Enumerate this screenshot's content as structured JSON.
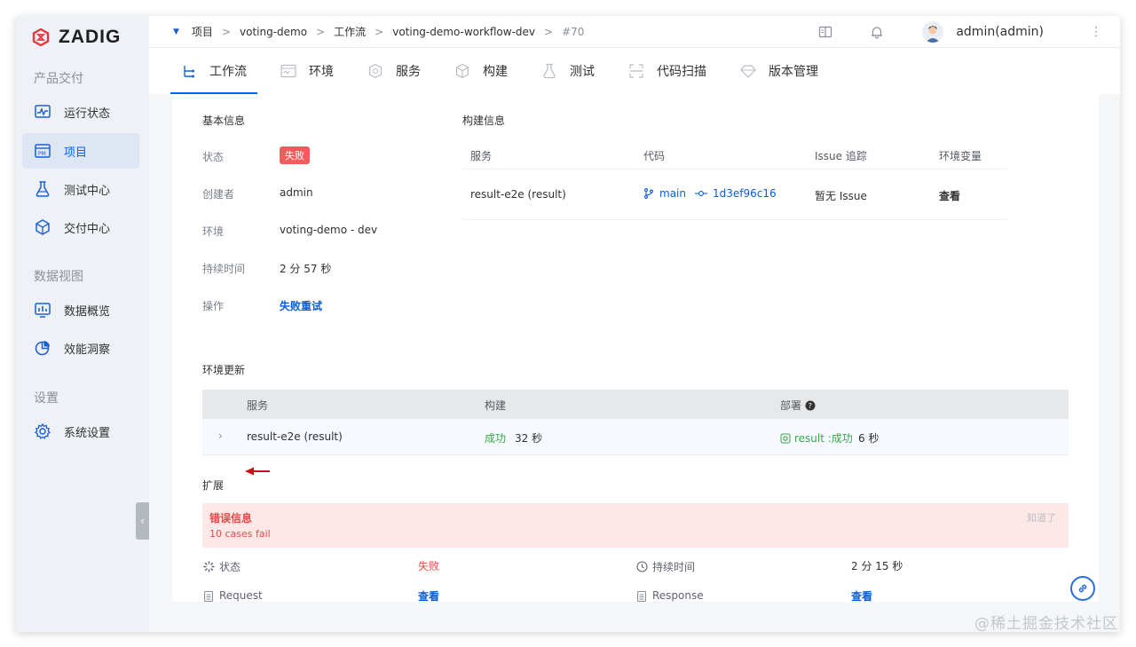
{
  "app": {
    "logo_text": "ZADIG"
  },
  "sidebar": {
    "sections": [
      {
        "title": "产品交付",
        "items": [
          {
            "label": "运行状态",
            "icon": "monitor-pulse-icon"
          },
          {
            "label": "项目",
            "icon": "project-pm-icon",
            "active": true
          },
          {
            "label": "测试中心",
            "icon": "flask-icon"
          },
          {
            "label": "交付中心",
            "icon": "package-icon"
          }
        ]
      },
      {
        "title": "数据视图",
        "items": [
          {
            "label": "数据概览",
            "icon": "dashboard-icon"
          },
          {
            "label": "效能洞察",
            "icon": "pie-chart-icon"
          }
        ]
      },
      {
        "title": "设置",
        "items": [
          {
            "label": "系统设置",
            "icon": "gear-icon"
          }
        ]
      }
    ]
  },
  "breadcrumb": {
    "items": [
      "项目",
      "voting-demo",
      "工作流",
      "voting-demo-workflow-dev",
      "#70"
    ],
    "sep": ">"
  },
  "user": {
    "name": "admin(admin)"
  },
  "tabs": [
    {
      "label": "工作流",
      "active": true
    },
    {
      "label": "环境"
    },
    {
      "label": "服务"
    },
    {
      "label": "构建"
    },
    {
      "label": "测试"
    },
    {
      "label": "代码扫描"
    },
    {
      "label": "版本管理"
    }
  ],
  "basic_info": {
    "title": "基本信息",
    "status_label": "状态",
    "status_value": "失败",
    "creator_label": "创建者",
    "creator_value": "admin",
    "env_label": "环境",
    "env_value": "voting-demo - dev",
    "duration_label": "持续时间",
    "duration_value": "2 分 57 秒",
    "action_label": "操作",
    "action_value": "失败重试"
  },
  "build_info": {
    "title": "构建信息",
    "headers": [
      "服务",
      "代码",
      "Issue 追踪",
      "环境变量"
    ],
    "row": {
      "service": "result-e2e (result)",
      "branch": "main",
      "commit": "1d3ef96c16",
      "issue": "暂无 Issue",
      "env_vars": "查看"
    }
  },
  "env_update": {
    "title": "环境更新",
    "headers": [
      "服务",
      "构建",
      "部署"
    ],
    "row": {
      "service": "result-e2e (result)",
      "build_status": "成功",
      "build_time": "32 秒",
      "deploy_status": "result :成功",
      "deploy_time": "6 秒"
    }
  },
  "extension": {
    "title": "扩展",
    "error_title": "错误信息",
    "error_msg": "10 cases fail",
    "dismiss": "知道了",
    "status_label": "状态",
    "status_value": "失败",
    "duration_label": "持续时间",
    "duration_value": "2 分 15 秒",
    "request_label": "Request",
    "request_value": "查看",
    "response_label": "Response",
    "response_value": "查看"
  },
  "watermark": "@稀土掘金技术社区",
  "colors": {
    "accent": "#0066ff",
    "fail": "#f25c5c",
    "success": "#39a84a",
    "link": "#0a5cd6"
  }
}
